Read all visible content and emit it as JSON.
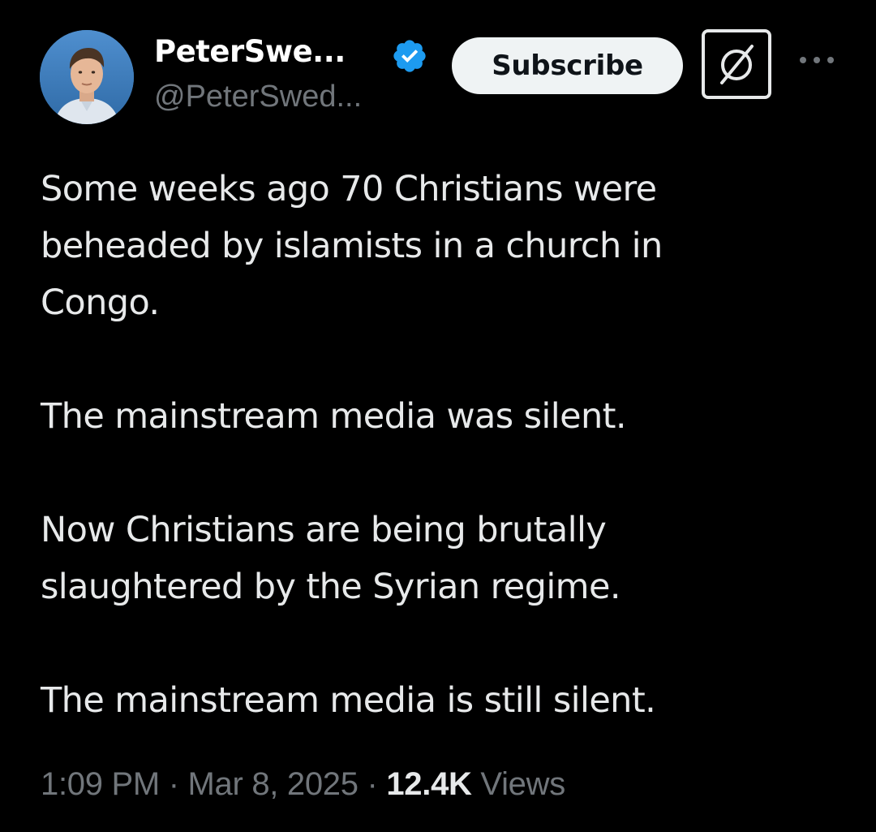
{
  "author": {
    "display_name": "PeterSwe...",
    "handle": "@PeterSwed...",
    "verified": true,
    "verified_color": "#1d9bf0"
  },
  "header": {
    "subscribe_label": "Subscribe",
    "grok_icon": "slashed-circle-icon",
    "more_icon": "more-horizontal-icon"
  },
  "tweet": {
    "paragraphs": [
      "Some weeks ago 70 Christians were\nbeheaded by islamists in a church in\nCongo.",
      "The mainstream media was silent.",
      "Now Christians are being brutally\nslaughtered by the Syrian regime.",
      "The mainstream media is still silent."
    ]
  },
  "meta": {
    "time": "1:09 PM",
    "separator": " · ",
    "date": "Mar 8, 2025",
    "views_count": "12.4K",
    "views_label": " Views"
  },
  "colors": {
    "background": "#000000",
    "text_primary": "#e7e9ea",
    "text_secondary": "#71767b",
    "button_bg": "#eff3f4"
  }
}
